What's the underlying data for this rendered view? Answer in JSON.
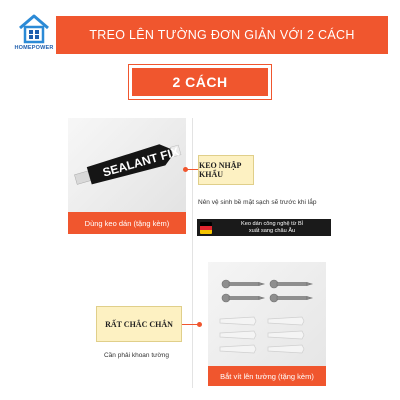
{
  "brand": {
    "logo_text": "HOMEPOWER"
  },
  "header": {
    "title": "TREO LÊN TƯỜNG ĐƠN GIẢN VỚI 2 CÁCH"
  },
  "methods": {
    "label": "2 CÁCH"
  },
  "glue_section": {
    "product_text": "SEALANT FIX",
    "caption": "Dùng keo dán (tặng kèm)",
    "tag": "KEO NHẬP KHẨU",
    "note": "Nên vệ sinh bề mặt sạch sẽ trước khi lắp",
    "origin_line1": "Keo dán công nghệ từ Bỉ",
    "origin_line2": "xuất sang châu Âu"
  },
  "screw_section": {
    "tag": "RẤT CHẮC CHẮN",
    "note": "Cần phải khoan tường",
    "caption": "Bắt vít lên tường (tặng kèm)"
  },
  "colors": {
    "accent": "#f0562e",
    "tag_bg": "#fdf1c2",
    "flag_black": "#000000",
    "flag_yellow": "#f5c400",
    "flag_red": "#e3262f"
  }
}
